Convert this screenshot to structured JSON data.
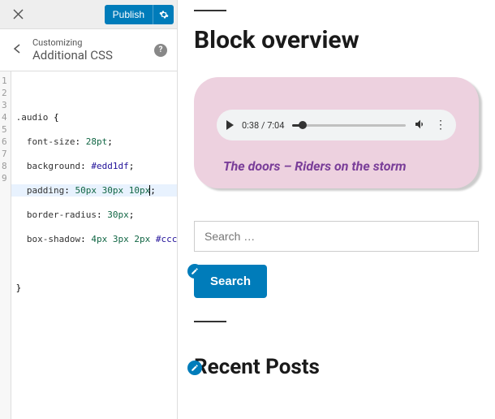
{
  "topbar": {
    "publish_label": "Publish"
  },
  "panel": {
    "subtitle": "Customizing",
    "title": "Additional CSS"
  },
  "code": {
    "lines": [
      "1",
      "2",
      "3",
      "4",
      "5",
      "6",
      "7",
      "8",
      "9"
    ],
    "l1": "",
    "l2_selector": ".audio",
    "l2_brace": " {",
    "l3_prop": "font-size",
    "l3_val": "28pt",
    "l4_prop": "background",
    "l4_val": "#edd1df",
    "l5_prop": "padding",
    "l5_v1": "50px",
    "l5_v2": "30px",
    "l5_v3": "10px",
    "l6_prop": "border-radius",
    "l6_val": "30px",
    "l7_prop": "box-shadow",
    "l7_v1": "4px",
    "l7_v2": "3px",
    "l7_v3": "2px",
    "l7_v4": "#ccc",
    "l9": "}"
  },
  "preview": {
    "block_title": "Block overview",
    "audio": {
      "time": "0:38 / 7:04",
      "caption": "The doors – Riders on the storm"
    },
    "search": {
      "placeholder": "Search …",
      "button": "Search"
    },
    "recent_posts_title": "Recent Posts"
  }
}
